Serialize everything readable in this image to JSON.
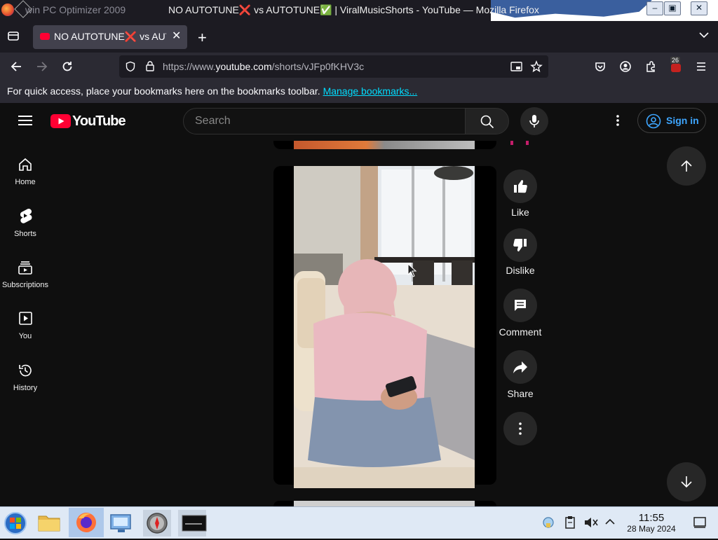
{
  "window": {
    "title": "NO AUTOTUNE❌ vs AUTOTUNE✅ | ViralMusicShorts - YouTube — Mozilla Firefox",
    "background_window_title": "win PC Optimizer 2009"
  },
  "tab": {
    "title": "NO AUTOTUNE❌ vs AUTOTUNE✅ | ViralMusicShorts - YouTube"
  },
  "url": {
    "prefix": "https://www.",
    "domain": "youtube.com",
    "path": "/shorts/vJFp0fKHV3c"
  },
  "toolbar": {
    "extensions_badge": "26"
  },
  "bookmarks_bar": {
    "message": "For quick access, place your bookmarks here on the bookmarks toolbar.",
    "link": "Manage bookmarks..."
  },
  "youtube": {
    "logo_text": "YouTube",
    "search_placeholder": "Search",
    "sign_in": "Sign in"
  },
  "sidebar": {
    "items": [
      {
        "label": "Home",
        "icon": "home-icon"
      },
      {
        "label": "Shorts",
        "icon": "shorts-icon"
      },
      {
        "label": "Subscriptions",
        "icon": "subscriptions-icon"
      },
      {
        "label": "You",
        "icon": "you-icon"
      },
      {
        "label": "History",
        "icon": "history-icon"
      }
    ]
  },
  "actions": {
    "like": "Like",
    "dislike": "Dislike",
    "comment": "Comment",
    "share": "Share"
  },
  "taskbar": {
    "time": "11:55",
    "date": "28 May 2024"
  },
  "colors": {
    "youtube_red": "#ff0033",
    "link_blue": "#3ea6ff",
    "firefox_link": "#00ddff"
  }
}
